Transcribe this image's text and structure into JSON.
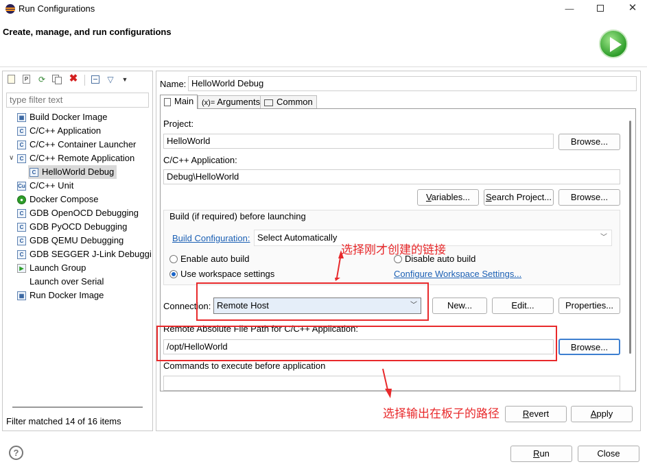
{
  "window": {
    "title": "Run Configurations",
    "header_title": "Create, manage, and run configurations",
    "controls": [
      "—",
      "☐",
      "✕"
    ]
  },
  "left": {
    "filter_placeholder": "type filter text",
    "items": [
      {
        "label": "Build Docker Image",
        "icon": "docker-image-icon"
      },
      {
        "label": "C/C++ Application",
        "icon": "c-app-icon"
      },
      {
        "label": "C/C++ Container Launcher",
        "icon": "c-app-icon"
      },
      {
        "label": "C/C++ Remote Application",
        "icon": "c-app-icon",
        "expanded": true
      },
      {
        "label": "HelloWorld Debug",
        "icon": "c-app-icon",
        "selected": true
      },
      {
        "label": "C/C++ Unit",
        "icon": "c-unit-icon"
      },
      {
        "label": "Docker Compose",
        "icon": "docker-compose-icon"
      },
      {
        "label": "GDB OpenOCD Debugging",
        "icon": "c-app-icon"
      },
      {
        "label": "GDB PyOCD Debugging",
        "icon": "c-app-icon"
      },
      {
        "label": "GDB QEMU Debugging",
        "icon": "c-app-icon"
      },
      {
        "label": "GDB SEGGER J-Link Debuggi",
        "icon": "c-app-icon"
      },
      {
        "label": "Launch Group",
        "icon": "launch-group-icon"
      },
      {
        "label": "Launch over Serial",
        "icon": ""
      },
      {
        "label": "Run Docker Image",
        "icon": "docker-run-icon"
      }
    ],
    "status": "Filter matched 14 of 16 items"
  },
  "form": {
    "name_label": "Name:",
    "name_value": "HelloWorld Debug",
    "tabs": [
      "Main",
      "Arguments",
      "Common"
    ],
    "project_label": "Project:",
    "project_value": "HelloWorld",
    "browse": "Browse...",
    "app_label": "C/C++ Application:",
    "app_value": "Debug\\HelloWorld",
    "variables": "Variables...",
    "search_project": "Search Project...",
    "build_group": "Build (if required) before launching",
    "build_config_link": "Build Configuration:",
    "build_config_value": "Select Automatically",
    "enable_auto": "Enable auto build",
    "disable_auto": "Disable auto build",
    "use_workspace": "Use workspace settings",
    "configure_ws": "Configure Workspace Settings...",
    "connection_label": "Connection:",
    "connection_value": "Remote Host",
    "new": "New...",
    "edit": "Edit...",
    "properties": "Properties...",
    "remote_path_label": "Remote Absolute File Path for C/C++ Application:",
    "remote_path_value": "/opt/HelloWorld",
    "commands_label": "Commands to execute before application",
    "revert": "Revert",
    "apply": "Apply"
  },
  "footer": {
    "run": "Run",
    "close": "Close"
  },
  "annotations": {
    "top": "选择刚才创建的链接",
    "bottom": "选择输出在板子的路径",
    "color": "#e8292b"
  }
}
